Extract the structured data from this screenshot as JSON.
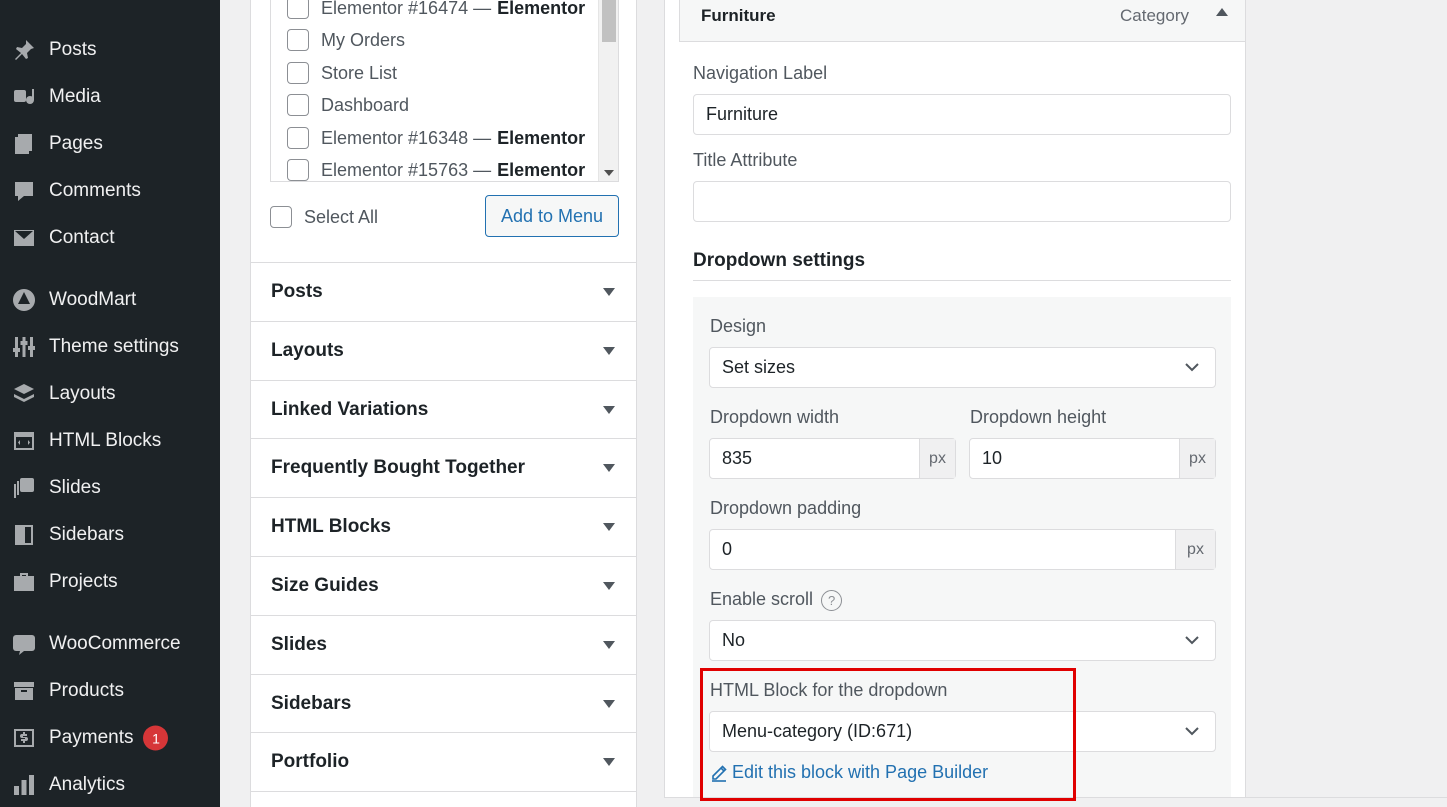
{
  "sidebar": {
    "items": [
      {
        "label": "Posts",
        "icon": "pin-icon"
      },
      {
        "label": "Media",
        "icon": "media-icon"
      },
      {
        "label": "Pages",
        "icon": "pages-icon"
      },
      {
        "label": "Comments",
        "icon": "comment-icon"
      },
      {
        "label": "Contact",
        "icon": "mail-icon"
      },
      {
        "label": "WoodMart",
        "icon": "woodmart-icon"
      },
      {
        "label": "Theme settings",
        "icon": "sliders-icon"
      },
      {
        "label": "Layouts",
        "icon": "layers-icon"
      },
      {
        "label": "HTML Blocks",
        "icon": "code-icon"
      },
      {
        "label": "Slides",
        "icon": "slides-icon"
      },
      {
        "label": "Sidebars",
        "icon": "sidebar-icon"
      },
      {
        "label": "Projects",
        "icon": "briefcase-icon"
      },
      {
        "label": "WooCommerce",
        "icon": "woo-icon"
      },
      {
        "label": "Products",
        "icon": "archive-icon"
      },
      {
        "label": "Payments",
        "icon": "dollar-icon",
        "badge": "1"
      },
      {
        "label": "Analytics",
        "icon": "chart-icon"
      }
    ]
  },
  "pages_list": {
    "rows": [
      {
        "label": "Elementor #16474 —",
        "bold": "Elementor"
      },
      {
        "label": "My Orders",
        "bold": ""
      },
      {
        "label": "Store List",
        "bold": ""
      },
      {
        "label": "Dashboard",
        "bold": ""
      },
      {
        "label": "Elementor #16348 —",
        "bold": "Elementor"
      },
      {
        "label": "Elementor #15763 —",
        "bold": "Elementor"
      }
    ],
    "select_all": "Select All",
    "add_to_menu": "Add to Menu"
  },
  "accordions": [
    "Posts",
    "Layouts",
    "Linked Variations",
    "Frequently Bought Together",
    "HTML Blocks",
    "Size Guides",
    "Slides",
    "Sidebars",
    "Portfolio"
  ],
  "menu_item": {
    "title": "Furniture",
    "type": "Category",
    "nav_label_caption": "Navigation Label",
    "nav_label_value": "Furniture",
    "title_attr_caption": "Title Attribute",
    "title_attr_value": "",
    "dropdown_section": "Dropdown settings",
    "design_caption": "Design",
    "design_value": "Set sizes",
    "width_caption": "Dropdown width",
    "width_value": "835",
    "height_caption": "Dropdown height",
    "height_value": "10",
    "padding_caption": "Dropdown padding",
    "padding_value": "0",
    "unit": "px",
    "scroll_caption": "Enable scroll",
    "help": "?",
    "scroll_value": "No",
    "html_block_caption": "HTML Block for the dropdown",
    "html_block_value": "Menu-category (ID:671)",
    "edit_link": "Edit this block with Page Builder"
  },
  "colors": {
    "sidebar_bg": "#1d2327",
    "accent": "#2271b1",
    "highlight_frame": "#e00000",
    "badge": "#d63638"
  }
}
